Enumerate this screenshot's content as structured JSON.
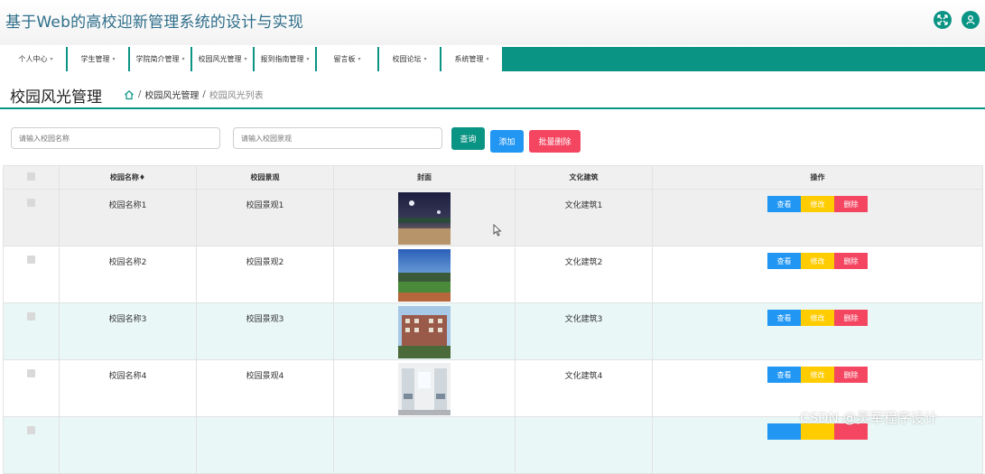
{
  "header": {
    "title": "基于Web的高校迎新管理系统的设计与实现",
    "icons": [
      "fullscreen-icon",
      "user-icon"
    ]
  },
  "nav": {
    "items": [
      {
        "label": "个人中心",
        "caret": "▾"
      },
      {
        "label": "学生管理",
        "caret": "▾"
      },
      {
        "label": "学院简介管理",
        "caret": "▾"
      },
      {
        "label": "校园风光管理",
        "caret": "▾"
      },
      {
        "label": "报到指南管理",
        "caret": "▾"
      },
      {
        "label": "留言板",
        "caret": "▾"
      },
      {
        "label": "校园论坛",
        "caret": "▾"
      },
      {
        "label": "系统管理",
        "caret": "▾"
      }
    ]
  },
  "page": {
    "title": "校园风光管理",
    "breadcrumb": [
      "校园风光管理",
      "校园风光列表"
    ],
    "separator": "/"
  },
  "search": {
    "name_placeholder": "请输入校园名称",
    "scenery_placeholder": "请输入校园景观",
    "query_label": "查询",
    "add_label": "添加",
    "batch_delete_label": "批量删除"
  },
  "table": {
    "headers": [
      "校园名称♦",
      "校园景观",
      "封面",
      "文化建筑",
      "操作"
    ],
    "rows": [
      {
        "name": "校园名称1",
        "scenery": "校园景观1",
        "cover": "night-campus-photo",
        "building": "文化建筑1"
      },
      {
        "name": "校园名称2",
        "scenery": "校园景观2",
        "cover": "sports-field-photo",
        "building": "文化建筑2"
      },
      {
        "name": "校园名称3",
        "scenery": "校园景观3",
        "cover": "campus-building-photo",
        "building": "文化建筑3"
      },
      {
        "name": "校园名称4",
        "scenery": "校园景观4",
        "cover": "dormitory-room-photo",
        "building": "文化建筑4"
      }
    ],
    "actions": {
      "view": "查看",
      "edit": "修改",
      "delete": "删除"
    }
  },
  "watermark": "CSDN @灵军程序设计",
  "colors": {
    "primary": "#0a9484",
    "view": "#2196f3",
    "edit": "#ffcc00",
    "delete": "#f44661",
    "title": "#2e6e8a"
  }
}
